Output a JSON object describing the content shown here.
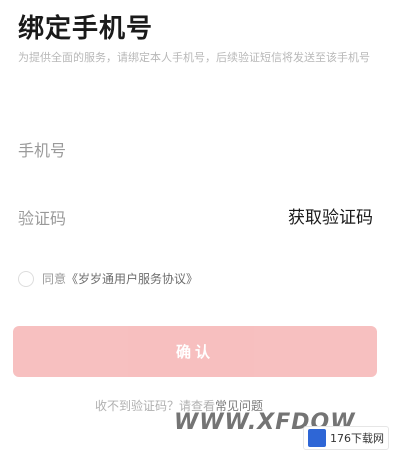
{
  "header": {
    "title": "绑定手机号",
    "subtitle": "为提供全面的服务，请绑定本人手机号，后续验证短信将发送至该手机号"
  },
  "form": {
    "phone_placeholder": "手机号",
    "code_placeholder": "验证码",
    "get_code_label": "获取验证码"
  },
  "agreement": {
    "prefix": "同意",
    "link": "《岁岁通用户服务协议》"
  },
  "submit_label": "确认",
  "help": {
    "prefix": "收不到验证码？请查看",
    "link": "常见问题"
  },
  "watermark": {
    "text": "WWW.XFDOW",
    "logo_text": "176下载网"
  },
  "colors": {
    "accent_button": "#f6b5b5",
    "placeholder": "#9a9a9a"
  }
}
